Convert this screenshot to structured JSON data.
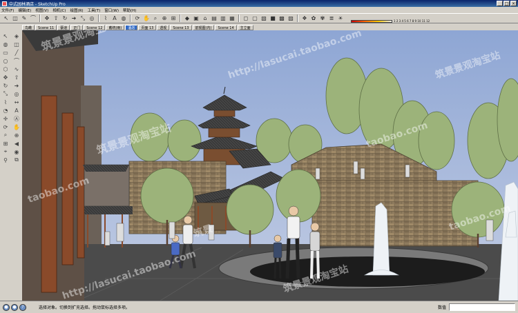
{
  "window": {
    "title": "中式园林酒店 - SketchUp Pro"
  },
  "menu": [
    "文件(F)",
    "编辑(E)",
    "视图(V)",
    "相机(C)",
    "绘图(R)",
    "工具(T)",
    "窗口(W)",
    "帮助(H)"
  ],
  "scale": {
    "ticks": "1 2 3 4 5 6 7 8 9 10 11 12"
  },
  "scenes": [
    {
      "label": "鸟瞰",
      "active": false
    },
    {
      "label": "Scene 11",
      "active": false
    },
    {
      "label": "蔡道",
      "active": false
    },
    {
      "label": "正门",
      "active": false
    },
    {
      "label": "Scene 12",
      "active": false
    },
    {
      "label": "戴统(雨)",
      "active": false
    },
    {
      "label": "酒店",
      "active": true
    },
    {
      "label": "页面 13",
      "active": false
    },
    {
      "label": "透视",
      "active": false
    },
    {
      "label": "Scene 13",
      "active": false
    },
    {
      "label": "前视图(内)",
      "active": false
    },
    {
      "label": "Scene 14",
      "active": false
    },
    {
      "label": "主立面",
      "active": false
    }
  ],
  "status": {
    "message": "选择对象。切换到扩充选择。拖动鼠标选择多项。",
    "vcb_label": "数值",
    "vcb_value": ""
  },
  "watermarks": {
    "cn": "筑景景观淘宝站",
    "url": "http://lasucai.taobao.com",
    "short": "taobao.com",
    "cn2": "筑景"
  },
  "colors": {
    "sky": "#9fb4d8",
    "ground": "#4a4a4a",
    "column": "#8a4a2a",
    "tree": "#9cb37a",
    "stone": "#8e7b5e",
    "roof": "#3a3a3a"
  }
}
